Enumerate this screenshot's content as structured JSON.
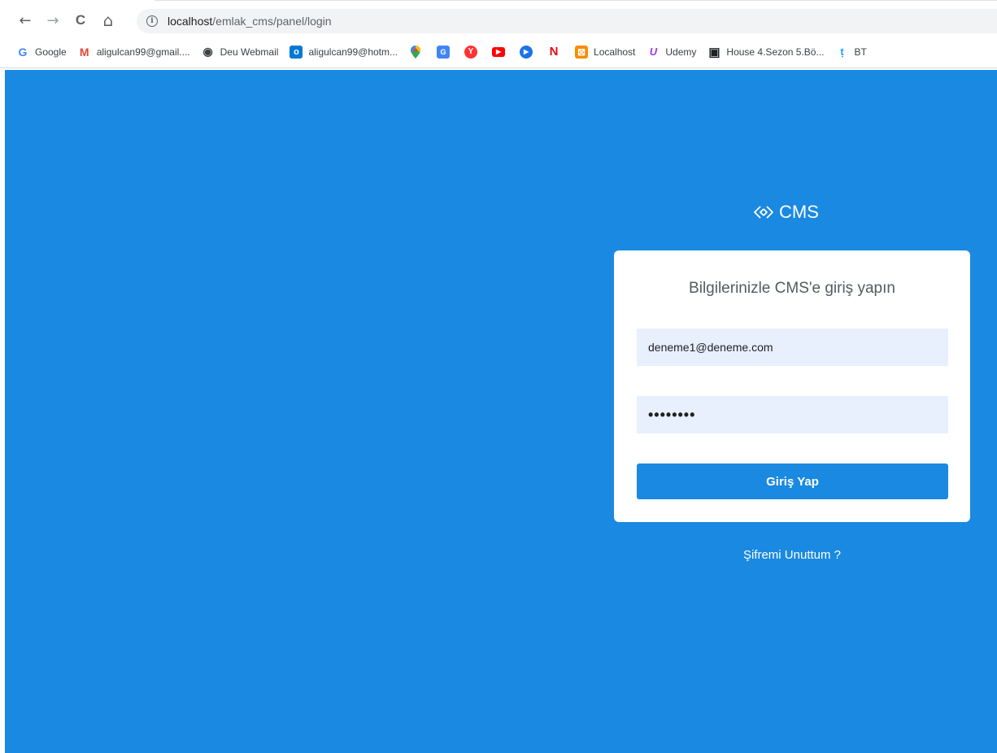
{
  "browser": {
    "url_host": "localhost",
    "url_path": "/emlak_cms/panel/login",
    "nav": {
      "back": "←",
      "forward": "→",
      "reload": "C",
      "home": "⌂"
    },
    "bookmarks": [
      {
        "label": "Google",
        "icon": "G",
        "color": "#4285f4"
      },
      {
        "label": "aligulcan99@gmail....",
        "icon": "M",
        "color": "#ea4335"
      },
      {
        "label": "Deu Webmail",
        "icon": "◉",
        "color": "#3c4043"
      },
      {
        "label": "aligulcan99@hotm...",
        "icon": "o",
        "color": "#0078d4"
      }
    ],
    "icon_bookmarks": [
      {
        "name": "maps",
        "icon": "●",
        "color": "#34a853"
      },
      {
        "name": "translate",
        "icon": "G",
        "color": "#4285f4"
      },
      {
        "name": "yandex",
        "icon": "Y",
        "color": "#ff3333"
      },
      {
        "name": "youtube",
        "icon": "▶",
        "color": "#ff0000"
      },
      {
        "name": "play",
        "icon": "▶",
        "color": "#1a73e8"
      },
      {
        "name": "netflix",
        "icon": "N",
        "color": "#e50914"
      }
    ],
    "bookmarks_2": [
      {
        "label": "Localhost",
        "icon": "⊠",
        "color": "#fb8c00"
      },
      {
        "label": "Udemy",
        "icon": "U",
        "color": "#a435f0"
      },
      {
        "label": "House 4.Sezon 5.Bö...",
        "icon": "▣",
        "color": "#202124"
      },
      {
        "label": "BT",
        "icon": "ṭ",
        "color": "#1da1f2"
      }
    ]
  },
  "page": {
    "background": "#1a89e1",
    "brand": "CMS",
    "card_title": "Bilgilerinizle CMS'e giriş yapın",
    "email_value": "deneme1@deneme.com",
    "password_value": "••••••••",
    "login_button": "Giriş Yap",
    "forgot_link": "Şifremi Unuttum ?"
  }
}
